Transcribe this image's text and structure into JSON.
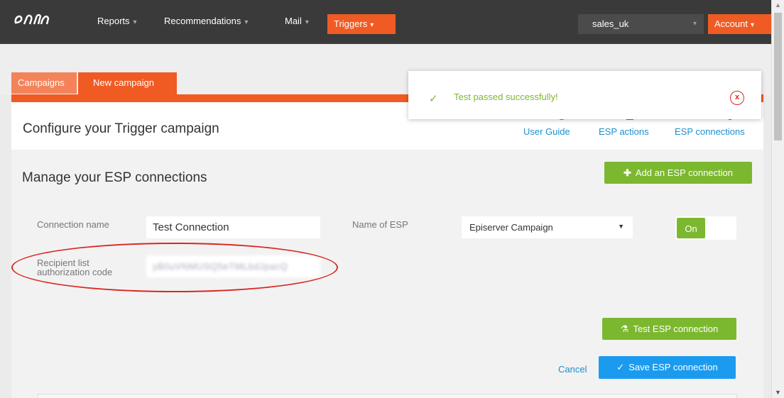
{
  "nav": {
    "items": [
      {
        "label": "Reports"
      },
      {
        "label": "Recommendations"
      },
      {
        "label": "Mail"
      }
    ],
    "triggers_label": "Triggers",
    "site_select": "sales_uk",
    "account_label": "Account",
    "caret": "▾"
  },
  "tabs": {
    "campaigns": "Campaigns",
    "new_campaign": "New campaign"
  },
  "header": {
    "title": "Configure your Trigger campaign",
    "links": [
      "User Guide",
      "ESP actions",
      "ESP connections"
    ]
  },
  "main": {
    "title": "Manage your ESP connections",
    "add_button": "Add an ESP connection",
    "connection_name_label": "Connection name",
    "connection_name_value": "Test Connection",
    "esp_label": "Name of ESP",
    "esp_value": "Episerver Campaign",
    "toggle_label": "On",
    "auth_label_line1": "Recipient list",
    "auth_label_line2": "authorization code",
    "auth_value": "yB0uVNMUSQ5eTMLbdJpacQ",
    "test_button": "Test ESP connection",
    "cancel_label": "Cancel",
    "save_button": "Save ESP connection"
  },
  "toast": {
    "message": "Test passed successfully!",
    "close": "x"
  },
  "colors": {
    "accent_orange": "#f05b24",
    "green": "#7cb82f",
    "blue": "#1b9bf0",
    "link": "#1b8fd1",
    "annotation_red": "#d9281f"
  }
}
